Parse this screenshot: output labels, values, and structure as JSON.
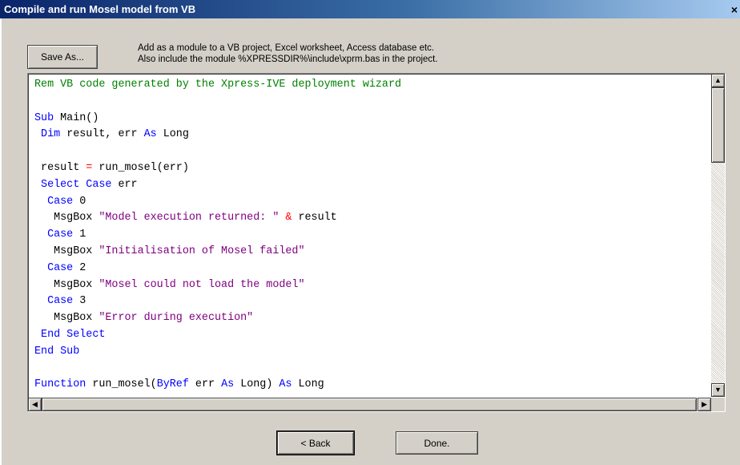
{
  "window": {
    "title": "Compile and run Mosel model from VB",
    "close_glyph": "×"
  },
  "toolbar": {
    "save_as_label": "Save As...",
    "info_line1": "Add as a module to a VB project, Excel worksheet, Access database etc.",
    "info_line2": "Also include the module %XPRESSDIR%\\include\\xprm.bas in the project."
  },
  "editor": {
    "language": "VB",
    "lines": [
      [
        {
          "t": "Rem VB code generated by the Xpress-IVE deployment wizard",
          "c": "cm"
        }
      ],
      [],
      [
        {
          "t": "Sub",
          "c": "kw"
        },
        {
          "t": " Main()",
          "c": ""
        }
      ],
      [
        {
          "t": " Dim",
          "c": "kw"
        },
        {
          "t": " result, err ",
          "c": ""
        },
        {
          "t": "As",
          "c": "kw"
        },
        {
          "t": " Long",
          "c": ""
        }
      ],
      [],
      [
        {
          "t": " result ",
          "c": ""
        },
        {
          "t": "=",
          "c": "op"
        },
        {
          "t": " run_mosel(err)",
          "c": ""
        }
      ],
      [
        {
          "t": " Select Case",
          "c": "kw"
        },
        {
          "t": " err",
          "c": ""
        }
      ],
      [
        {
          "t": "  Case",
          "c": "kw"
        },
        {
          "t": " 0",
          "c": ""
        }
      ],
      [
        {
          "t": "   MsgBox ",
          "c": ""
        },
        {
          "t": "\"Model execution returned: \"",
          "c": "st"
        },
        {
          "t": " ",
          "c": ""
        },
        {
          "t": "&",
          "c": "op"
        },
        {
          "t": " result",
          "c": ""
        }
      ],
      [
        {
          "t": "  Case",
          "c": "kw"
        },
        {
          "t": " 1",
          "c": ""
        }
      ],
      [
        {
          "t": "   MsgBox ",
          "c": ""
        },
        {
          "t": "\"Initialisation of Mosel failed\"",
          "c": "st"
        }
      ],
      [
        {
          "t": "  Case",
          "c": "kw"
        },
        {
          "t": " 2",
          "c": ""
        }
      ],
      [
        {
          "t": "   MsgBox ",
          "c": ""
        },
        {
          "t": "\"Mosel could not load the model\"",
          "c": "st"
        }
      ],
      [
        {
          "t": "  Case",
          "c": "kw"
        },
        {
          "t": " 3",
          "c": ""
        }
      ],
      [
        {
          "t": "   MsgBox ",
          "c": ""
        },
        {
          "t": "\"Error during execution\"",
          "c": "st"
        }
      ],
      [
        {
          "t": " End Select",
          "c": "kw"
        }
      ],
      [
        {
          "t": "End Sub",
          "c": "kw"
        }
      ],
      [],
      [
        {
          "t": "Function",
          "c": "kw"
        },
        {
          "t": " run_mosel(",
          "c": ""
        },
        {
          "t": "ByRef",
          "c": "kw"
        },
        {
          "t": " err ",
          "c": ""
        },
        {
          "t": "As",
          "c": "kw"
        },
        {
          "t": " Long) ",
          "c": ""
        },
        {
          "t": "As",
          "c": "kw"
        },
        {
          "t": " Long",
          "c": ""
        }
      ]
    ],
    "vertical_scroll_position": 0,
    "horizontal_scroll_position": 0
  },
  "scrollbar": {
    "up_glyph": "▲",
    "down_glyph": "▼",
    "left_glyph": "◀",
    "right_glyph": "▶"
  },
  "footer": {
    "back_label": "< Back",
    "done_label": "Done."
  },
  "colors": {
    "keyword": "#0000ff",
    "comment": "#008000",
    "string": "#800080",
    "operator": "#ff0000",
    "dialog_bg": "#d4d0c8"
  }
}
